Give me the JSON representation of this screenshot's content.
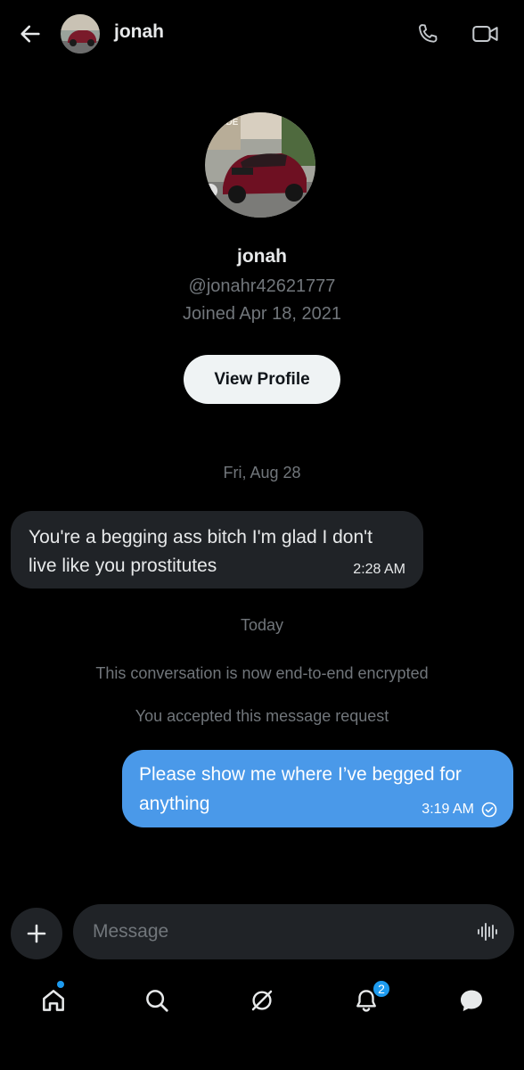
{
  "header": {
    "title": "jonah",
    "icons": {
      "back": "back-arrow-icon",
      "call": "phone-icon",
      "video": "video-camera-icon"
    }
  },
  "profile": {
    "name": "jonah",
    "handle": "@jonahr42621777",
    "joined": "Joined Apr 18, 2021",
    "view_profile_label": "View Profile",
    "avatar_sign_text": "SIDE"
  },
  "conversation": {
    "date_separator_1": "Fri, Aug 28",
    "incoming_message": {
      "text": "You're a begging ass bitch I'm glad I don't live like you prostitutes",
      "time": "2:28 AM"
    },
    "date_separator_2": "Today",
    "system_note_1": "This conversation is now end-to-end encrypted",
    "system_note_2": "You accepted this message request",
    "outgoing_message": {
      "text": "Please show me where I’ve begged for anything",
      "time": "3:19 AM",
      "status_icon": "read-check-icon"
    }
  },
  "composer": {
    "placeholder": "Message",
    "icons": {
      "add": "plus-icon",
      "voice": "voice-waveform-icon"
    }
  },
  "bottom_nav": {
    "items": [
      "home-icon",
      "search-icon",
      "grok-icon",
      "notifications-icon",
      "messages-icon"
    ],
    "notifications_badge": "2"
  },
  "colors": {
    "background": "#000000",
    "incoming_bubble": "#202327",
    "outgoing_bubble": "#4a99e9",
    "secondary_text": "#71767b",
    "accent": "#1d9bf0"
  }
}
